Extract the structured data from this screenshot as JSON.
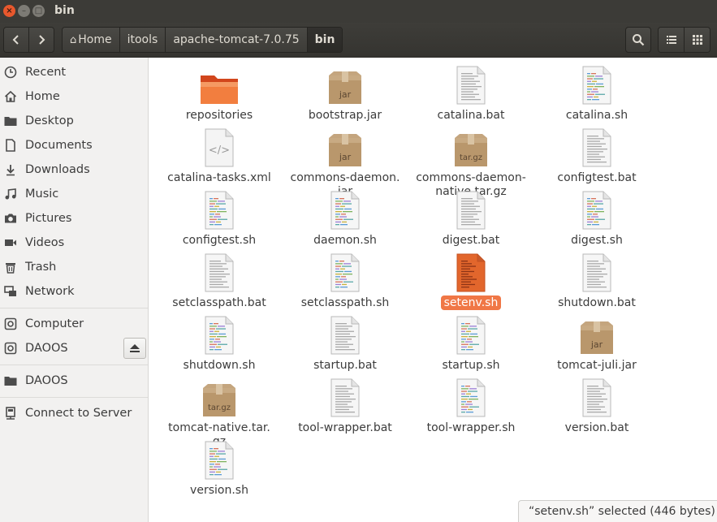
{
  "window": {
    "title": "bin"
  },
  "toolbar": {
    "back_icon": "back-arrow-icon",
    "forward_icon": "forward-arrow-icon",
    "breadcrumbs": [
      "Home",
      "itools",
      "apache-tomcat-7.0.75",
      "bin"
    ],
    "search_icon": "search-icon",
    "list_view_icon": "list-view-icon",
    "grid_view_icon": "grid-view-icon"
  },
  "sidebar": {
    "items": [
      {
        "label": "Recent",
        "icon": "clock-icon"
      },
      {
        "label": "Home",
        "icon": "home-icon"
      },
      {
        "label": "Desktop",
        "icon": "folder-icon"
      },
      {
        "label": "Documents",
        "icon": "document-icon"
      },
      {
        "label": "Downloads",
        "icon": "download-icon"
      },
      {
        "label": "Music",
        "icon": "music-icon"
      },
      {
        "label": "Pictures",
        "icon": "camera-icon"
      },
      {
        "label": "Videos",
        "icon": "video-icon"
      },
      {
        "label": "Trash",
        "icon": "trash-icon"
      },
      {
        "label": "Network",
        "icon": "network-icon"
      },
      {
        "label": "Computer",
        "icon": "drive-icon"
      },
      {
        "label": "DAOOS",
        "icon": "drive-icon"
      },
      {
        "label": "DAOOS",
        "icon": "folder-icon"
      },
      {
        "label": "Connect to Server",
        "icon": "server-icon"
      }
    ]
  },
  "files": [
    {
      "name": "repositories",
      "type": "folder"
    },
    {
      "name": "bootstrap.jar",
      "type": "archive",
      "badge": "jar"
    },
    {
      "name": "catalina.bat",
      "type": "text"
    },
    {
      "name": "catalina.sh",
      "type": "script"
    },
    {
      "name": "catalina-tasks.xml",
      "type": "xml"
    },
    {
      "name": "commons-daemon.\njar",
      "type": "archive",
      "badge": "jar"
    },
    {
      "name": "commons-daemon-\nnative.tar.gz",
      "type": "archive",
      "badge": "tar.gz"
    },
    {
      "name": "configtest.bat",
      "type": "text"
    },
    {
      "name": "configtest.sh",
      "type": "script"
    },
    {
      "name": "daemon.sh",
      "type": "script"
    },
    {
      "name": "digest.bat",
      "type": "text"
    },
    {
      "name": "digest.sh",
      "type": "script"
    },
    {
      "name": "setclasspath.bat",
      "type": "text"
    },
    {
      "name": "setclasspath.sh",
      "type": "script"
    },
    {
      "name": "setenv.sh",
      "type": "script",
      "selected": true
    },
    {
      "name": "shutdown.bat",
      "type": "text"
    },
    {
      "name": "shutdown.sh",
      "type": "script"
    },
    {
      "name": "startup.bat",
      "type": "text"
    },
    {
      "name": "startup.sh",
      "type": "script"
    },
    {
      "name": "tomcat-juli.jar",
      "type": "archive",
      "badge": "jar"
    },
    {
      "name": "tomcat-native.tar.\ngz",
      "type": "archive",
      "badge": "tar.gz"
    },
    {
      "name": "tool-wrapper.bat",
      "type": "text"
    },
    {
      "name": "tool-wrapper.sh",
      "type": "script"
    },
    {
      "name": "version.bat",
      "type": "text"
    },
    {
      "name": "version.sh",
      "type": "script"
    }
  ],
  "status": {
    "text": "“setenv.sh” selected  (446 bytes)"
  },
  "colors": {
    "accent": "#f07746",
    "titlebar": "#3c3b37",
    "sidebar": "#f2f1f0"
  }
}
